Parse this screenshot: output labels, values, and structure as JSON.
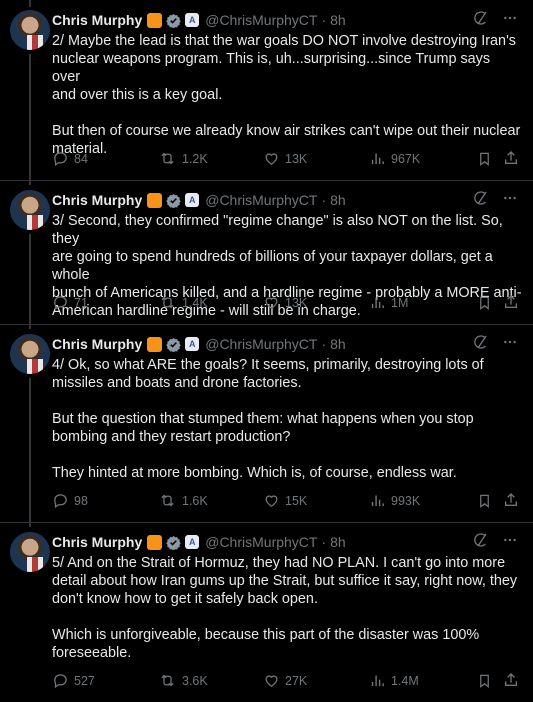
{
  "author": {
    "name": "Chris Murphy",
    "handle": "@ChrisMurphyCT",
    "separator": "·",
    "time": "8h",
    "gov_badge": "A"
  },
  "colors": {
    "background": "#000000",
    "text": "#e7e9ea",
    "muted": "#71767b",
    "orange_badge": "#f7931a",
    "verified_blue": "#1d9bf0",
    "divider": "#2f3336"
  },
  "icons": [
    "grok-icon",
    "more-icon",
    "reply-icon",
    "repost-icon",
    "like-icon",
    "views-icon",
    "bookmark-icon",
    "share-icon"
  ],
  "tweets": [
    {
      "text": "2/ Maybe the lead is that the war goals DO NOT involve destroying Iran's\nnuclear weapons program. This is, uh...surprising...since Trump says over\nand over this is a key goal.\n\nBut then of course we already know air strikes can't wipe out their nuclear\nmaterial.",
      "replies": "84",
      "reposts": "1.2K",
      "likes": "13K",
      "views": "967K"
    },
    {
      "text": "3/ Second, they confirmed \"regime change\" is also NOT on the list. So, they\nare going to spend hundreds of billions of your taxpayer dollars, get a whole\nbunch of Americans killed, and a hardline regime - probably a MORE anti-\nAmerican hardline regime - will still be in charge.",
      "replies": "71",
      "reposts": "1.4K",
      "likes": "13K",
      "views": "1M"
    },
    {
      "text": "4/ Ok, so what ARE the goals? It seems, primarily, destroying lots of\nmissiles and boats and drone factories.\n\nBut the question that stumped them: what happens when you stop\nbombing and they restart production?\n\nThey hinted at more bombing. Which is, of course, endless war.",
      "replies": "98",
      "reposts": "1.6K",
      "likes": "15K",
      "views": "993K"
    },
    {
      "text": "5/ And on the Strait of Hormuz, they had NO PLAN. I can't go into more\ndetail about how Iran gums up the Strait, but suffice it say, right now, they\ndon't know how to get it safely back open.\n\nWhich is unforgiveable, because this part of the disaster was 100%\nforeseeable.",
      "replies": "527",
      "reposts": "3.6K",
      "likes": "27K",
      "views": "1.4M"
    }
  ]
}
